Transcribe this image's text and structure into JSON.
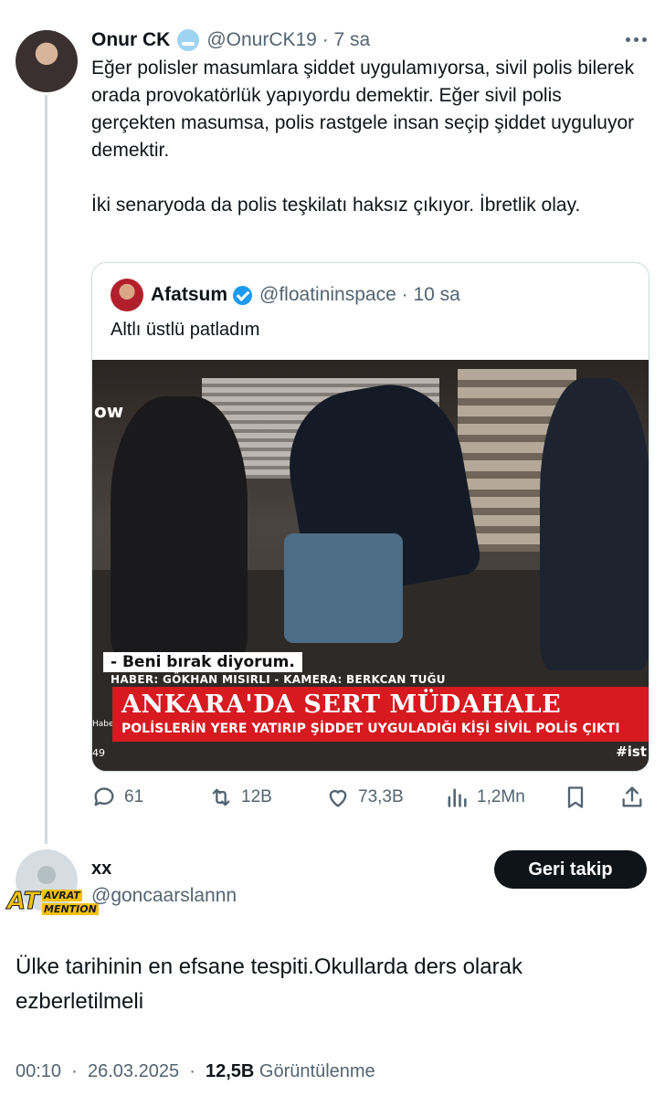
{
  "tweet": {
    "author_name": "Onur CK",
    "emoji": "🥶",
    "handle": "@OnurCK19",
    "separator": "·",
    "time": "7 sa",
    "text": "Eğer polisler masumlara şiddet uygulamıyorsa, sivil polis bilerek orada provokatörlük yapıyordu demektir. Eğer sivil polis gerçekten masumsa, polis rastgele insan seçip şiddet uyguluyor demektir.\n\nİki senaryoda da polis teşkilatı haksız çıkıyor. İbretlik olay.",
    "quote": {
      "author_name": "Afatsum",
      "handle": "@floatininspace",
      "separator": "·",
      "time": "10 sa",
      "text": "Altlı üstlü patladım",
      "media": {
        "caption_quote": "- Beni bırak diyorum.",
        "caption_credits": "HABER: GÖKHAN MISIRLI - KAMERA: BERKCAN TUĞU",
        "headline": "ANKARA'DA SERT MÜDAHALE",
        "subheadline": "POLİSLERİN YERE YATIRIP ŞİDDET UYGULADIĞI KİŞİ SİVİL POLİS ÇIKTI",
        "channel_tag": "#ist",
        "left_tag": "Haber",
        "counter": "49",
        "corner_text": "ow"
      }
    },
    "actions": {
      "replies": "61",
      "reposts": "12B",
      "likes": "73,3B",
      "views": "1,2Mn"
    }
  },
  "reply": {
    "author_name": "xx",
    "handle": "@goncaarslannn",
    "follow_label": "Geri takip",
    "badge": {
      "main": "AT",
      "top": "AVRAT",
      "bottom": "MENTION"
    },
    "text": "Ülke tarihinin en efsane tespiti.Okullarda ders olarak ezberletilmeli",
    "meta": {
      "time": "00:10",
      "separator": "·",
      "date": "26.03.2025",
      "separator2": "·",
      "views_count": "12,5B",
      "views_label": "Görüntülenme"
    }
  },
  "colors": {
    "accent": "#1d9bf0",
    "muted": "#536471",
    "border": "#cfd9de",
    "news_red": "#d71920"
  }
}
